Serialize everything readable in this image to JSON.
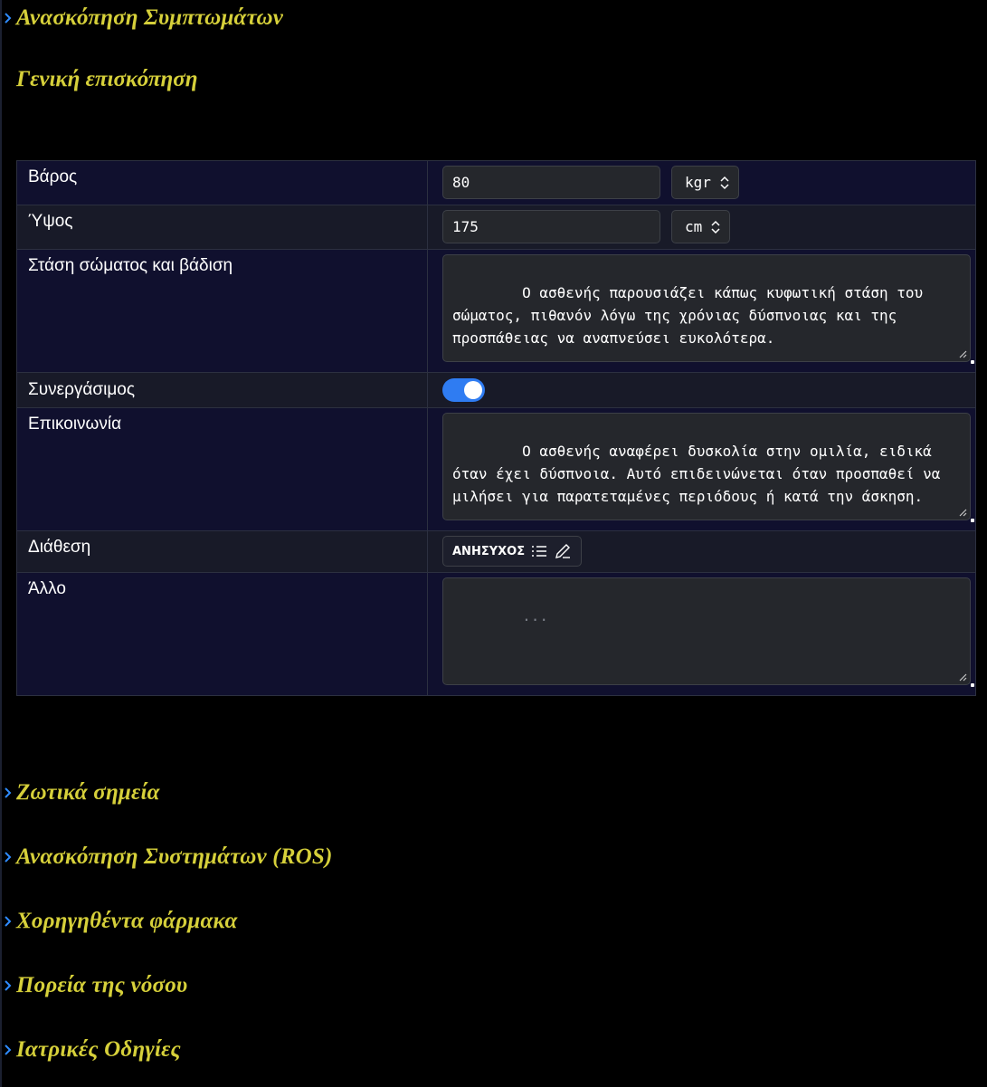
{
  "sections": {
    "symptoms_review": "Ανασκόπηση Συμπτωμάτων",
    "general_overview": "Γενική επισκόπηση",
    "vitals": "Ζωτικά σημεία",
    "ros": "Ανασκόπηση Συστημάτων (ROS)",
    "medications": "Χορηγηθέντα φάρμακα",
    "disease_course": "Πορεία της νόσου",
    "medical_instructions": "Ιατρικές Οδηγίες"
  },
  "form": {
    "weight": {
      "label": "Βάρος",
      "value": "80",
      "unit": "kgr"
    },
    "height": {
      "label": "Ύψος",
      "value": "175",
      "unit": "cm"
    },
    "posture": {
      "label": "Στάση σώματος και βάδιση",
      "value": "Ο ασθενής παρουσιάζει κάπως κυφωτική στάση του σώματος, πιθανόν λόγω της χρόνιας δύσπνοιας και της προσπάθειας να αναπνεύσει ευκολότερα."
    },
    "cooperative": {
      "label": "Συνεργάσιμος",
      "on": true
    },
    "communication": {
      "label": "Επικοινωνία",
      "value": "Ο ασθενής αναφέρει δυσκολία στην ομιλία, ειδικά όταν έχει δύσπνοια. Αυτό επιδεινώνεται όταν προσπαθεί να μιλήσει για παρατεταμένες περιόδους ή κατά την άσκηση."
    },
    "mood": {
      "label": "Διάθεση",
      "value": "ΑΝΗΣΥΧΟΣ"
    },
    "other": {
      "label": "Άλλο",
      "placeholder": "..."
    }
  },
  "colors": {
    "heading": "#d6d03a",
    "chevron": "#2f8cff",
    "toggle_on": "#2f7cf2",
    "row_odd": "#10102e",
    "row_even": "#181a28"
  },
  "icons": [
    "chevron-right-icon",
    "select-arrows-icon",
    "list-icon",
    "pencil-icon",
    "resize-handle-icon"
  ]
}
